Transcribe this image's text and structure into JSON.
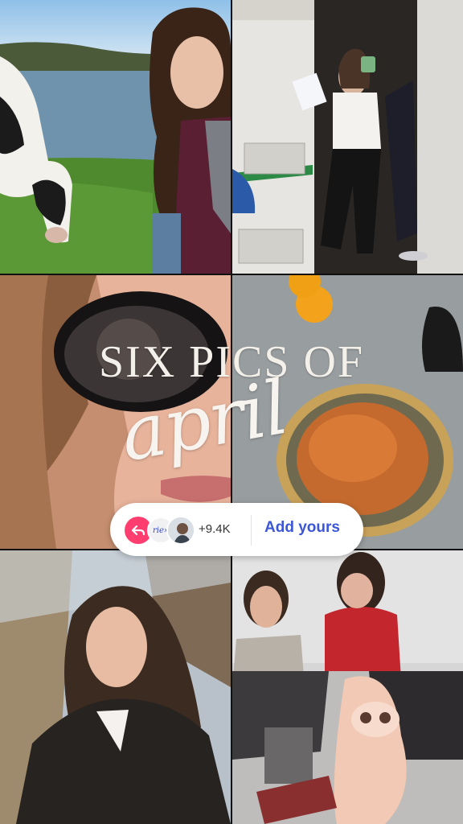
{
  "overlay": {
    "title": "SIX PICS OF",
    "script": "april"
  },
  "add_yours_sticker": {
    "avatar_text": "rie»",
    "count": "+9.4K",
    "action": "Add yours"
  },
  "colors": {
    "share_button": "#ff3d6e",
    "action_text": "#3c56d8"
  },
  "icons": [
    "share-arrow-icon"
  ]
}
